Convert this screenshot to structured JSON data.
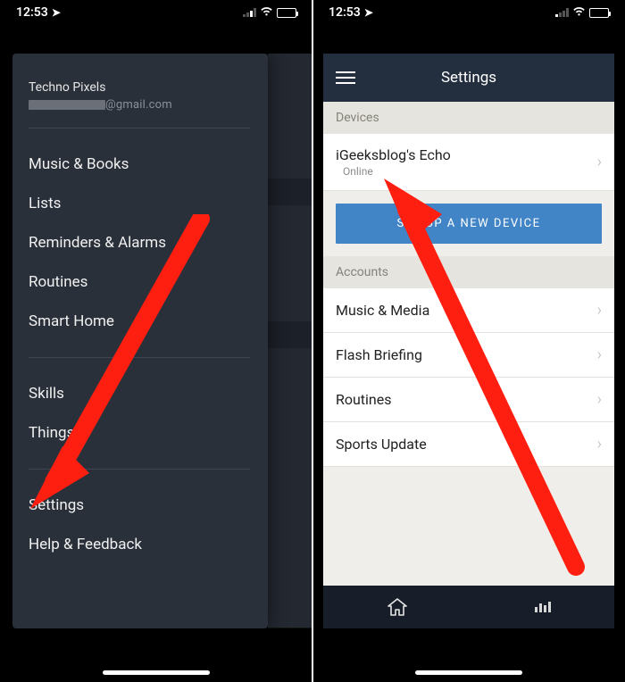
{
  "status": {
    "time": "12:53"
  },
  "left": {
    "profile_name": "Techno Pixels",
    "profile_email_suffix": "@gmail.com",
    "menu_group1": [
      "Music & Books",
      "Lists",
      "Reminders & Alarms",
      "Routines",
      "Smart Home"
    ],
    "menu_group2": [
      "Skills",
      "Things     ry"
    ],
    "menu_group3": [
      "Settings",
      "Help & Feedback"
    ]
  },
  "right": {
    "header_title": "Settings",
    "sections": {
      "devices_label": "Devices",
      "accounts_label": "Accounts"
    },
    "device": {
      "name": "iGeeksblog's Echo",
      "status": "Online"
    },
    "setup_button": "SET UP A NEW DEVICE",
    "account_items": [
      "Music & Media",
      "Flash Briefing",
      "Routines",
      "Sports Update"
    ]
  }
}
